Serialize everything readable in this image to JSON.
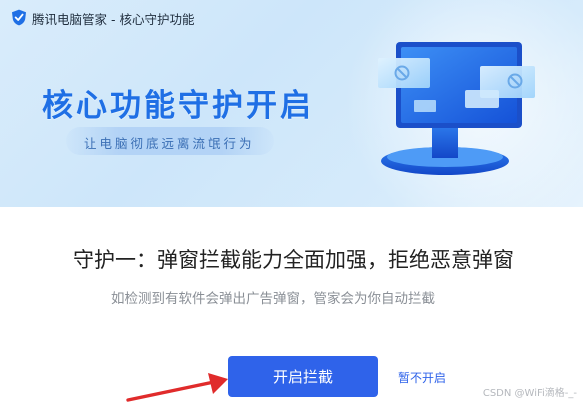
{
  "window": {
    "title": "腾讯电脑管家 - 核心守护功能",
    "logo_icon": "shield-logo-icon"
  },
  "banner": {
    "headline": "核心功能守护开启",
    "subtitle": "让电脑彻底远离流氓行为",
    "illustration_icon": "monitor-with-blocked-popups-icon"
  },
  "feature": {
    "title": "守护一：弹窗拦截能力全面加强，拒绝恶意弹窗",
    "description": "如检测到有软件会弹出广告弹窗，管家会为你自动拦截"
  },
  "actions": {
    "primary_label": "开启拦截",
    "secondary_label": "暂不开启"
  },
  "annotation": {
    "arrow_icon": "red-arrow-icon",
    "arrow_color": "#e02b2b"
  },
  "watermark": "CSDN @WiFi滴格-_-",
  "colors": {
    "accent": "#2f63ea",
    "headline": "#1f6fe5",
    "banner_bg": "#d9ecfb"
  }
}
